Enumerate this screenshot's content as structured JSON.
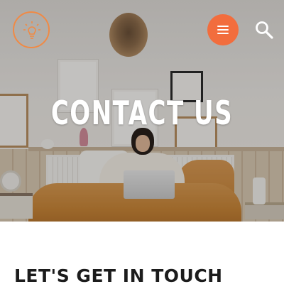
{
  "header": {
    "logo_icon": "lightbulb-icon",
    "menu_icon": "hamburger-menu-icon",
    "search_icon": "search-icon",
    "accent_color": "#f26d3d"
  },
  "hero": {
    "title": "CONTACT US"
  },
  "main": {
    "heading": "LET'S GET IN TOUCH"
  }
}
